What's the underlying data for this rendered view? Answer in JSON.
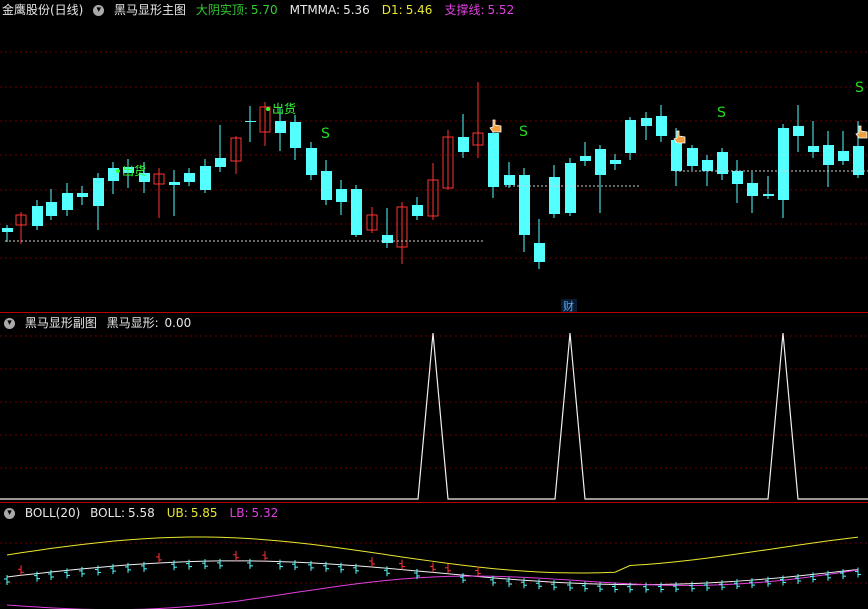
{
  "main": {
    "stock": "金鹰股份(日线)",
    "indicator": "黑马显形主图",
    "items": [
      {
        "label": "大阴实顶:",
        "value": "5.70",
        "color": "#33cc33"
      },
      {
        "label": "MTMMA:",
        "value": "5.36",
        "color": "#e8e8e8"
      },
      {
        "label": "D1:",
        "value": "5.46",
        "color": "#e8e830"
      },
      {
        "label": "支撑线:",
        "value": "5.52",
        "color": "#e040e0"
      }
    ],
    "signals": {
      "sell": "出货",
      "s": "S",
      "cai": "财"
    }
  },
  "sub": {
    "indicator": "黑马显形副图",
    "item": {
      "label": "黑马显形:",
      "value": "0.00",
      "color": "#e8e8e8"
    }
  },
  "boll": {
    "name": "BOLL(20)",
    "items": [
      {
        "label": "BOLL:",
        "value": "5.58",
        "color": "#e8e8e8"
      },
      {
        "label": "UB:",
        "value": "5.85",
        "color": "#e8e830"
      },
      {
        "label": "LB:",
        "value": "5.32",
        "color": "#e040e0"
      }
    ]
  },
  "colors": {
    "up": "#ff3333",
    "down": "#54ffff",
    "grid": "#6b0000",
    "sep": "#b00000"
  }
}
